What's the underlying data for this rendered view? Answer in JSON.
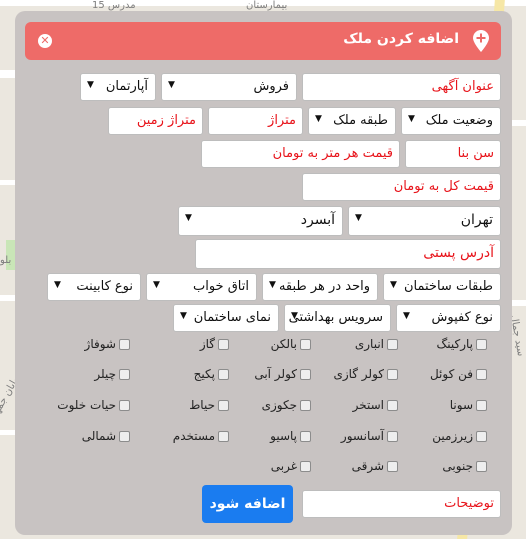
{
  "map": {
    "labels": [
      "بیمارستان",
      "15 مدرس",
      "بلو",
      "خیابان جمهوری",
      "سید جمال"
    ]
  },
  "dialog": {
    "title": "اضافه کردن ملک"
  },
  "fields": {
    "ad_title": "عنوان آگهی",
    "transaction_type": "فروش",
    "property_type": "آپارتمان",
    "property_status": "وضعیت ملک",
    "floor": "طبقه ملک",
    "area": "متراژ",
    "land_area": "متراژ زمین",
    "building_age": "سن بنا",
    "price_per_meter": "قیمت هر متر به تومان",
    "total_price": "قیمت کل به تومان",
    "city": "تهران",
    "district": "آبسرد",
    "postal_address": "آدرس پستی",
    "building_floors": "طبقات ساختمان",
    "units_per_floor": "واحد در هر طبقه",
    "bedrooms": "اتاق خواب",
    "cabinet_type": "نوع کابینت",
    "flooring_type": "نوع کفپوش",
    "bathroom": "سرویس بهداشتی",
    "facade": "نمای ساختمان",
    "description": "توضیحات"
  },
  "amenities": {
    "row1": [
      "پارکینگ",
      "انباری",
      "بالکن",
      "گاز",
      "شوفاژ"
    ],
    "row2": [
      "فن کوئل",
      "کولر گازی",
      "کولر آبی",
      "پکیج",
      "چیلر"
    ],
    "row3": [
      "سونا",
      "استخر",
      "جکوزی",
      "حیاط",
      "حیات خلوت"
    ],
    "row4": [
      "زیرزمین",
      "آسانسور",
      "پاسیو",
      "مستخدم",
      "شمالی"
    ],
    "row5": [
      "جنوبی",
      "شرقی",
      "غربی"
    ]
  },
  "submit_label": "اضافه شود"
}
